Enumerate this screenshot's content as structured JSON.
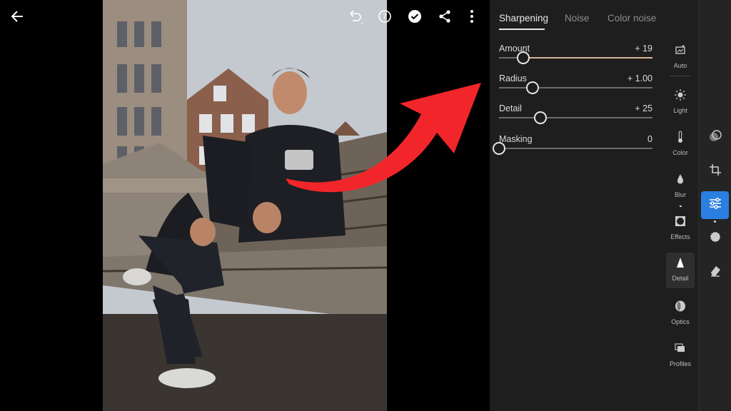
{
  "app": {
    "toolbar": {
      "back_icon": "arrow-left-icon",
      "undo_icon": "undo-icon",
      "help_icon": "help-icon",
      "done_icon": "checkmark-icon",
      "share_icon": "share-icon",
      "more_icon": "more-vertical-icon"
    },
    "photo": {
      "subject": "photo-canvas"
    }
  },
  "panel": {
    "tabs": [
      {
        "label": "Sharpening",
        "active": true
      },
      {
        "label": "Noise",
        "active": false
      },
      {
        "label": "Color noise",
        "active": false
      }
    ],
    "sliders": [
      {
        "label": "Amount",
        "value": "+ 19",
        "position": 0.16,
        "filled": true
      },
      {
        "label": "Radius",
        "value": "+ 1.00",
        "position": 0.22,
        "filled": false
      },
      {
        "label": "Detail",
        "value": "+ 25",
        "position": 0.27,
        "filled": false
      },
      {
        "label": "Masking",
        "value": "0",
        "position": 0.0,
        "filled": false
      }
    ]
  },
  "tools": [
    {
      "label": "Auto",
      "icon": "auto-icon"
    },
    {
      "label": "Light",
      "icon": "sun-icon"
    },
    {
      "label": "Color",
      "icon": "thermometer-icon"
    },
    {
      "label": "Blur",
      "icon": "drop-icon"
    },
    {
      "label": "Effects",
      "icon": "vignette-icon"
    },
    {
      "label": "Detail",
      "icon": "triangle-icon",
      "selected": true
    },
    {
      "label": "Optics",
      "icon": "lens-icon"
    },
    {
      "label": "Profiles",
      "icon": "profiles-icon"
    }
  ],
  "nav": [
    {
      "icon": "presets-icon"
    },
    {
      "icon": "crop-icon"
    },
    {
      "icon": "edit-sliders-icon",
      "active": true
    },
    {
      "icon": "healing-icon"
    },
    {
      "icon": "eraser-icon"
    }
  ],
  "colors": {
    "accent": "#2b7fe0",
    "panel_bg": "#1e1e1e",
    "arrow": "#f2262a",
    "amount_fill": "#d9b89a"
  }
}
